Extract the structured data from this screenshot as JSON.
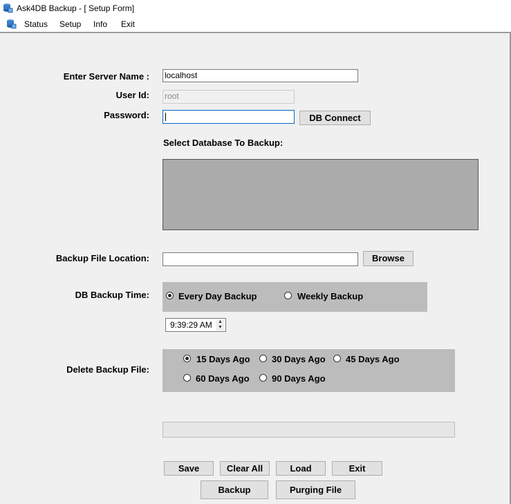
{
  "window": {
    "title": "Ask4DB Backup - [ Setup Form]"
  },
  "menu": {
    "items": [
      "Status",
      "Setup",
      "Info",
      "Exit"
    ]
  },
  "form": {
    "server_label": "Enter Server Name :",
    "server_value": "localhost",
    "userid_label": "User Id:",
    "userid_value": "root",
    "password_label": "Password:",
    "password_value": "",
    "db_connect_button": "DB Connect",
    "select_db_label": "Select Database  To Backup:",
    "backup_location_label": "Backup File Location:",
    "backup_location_value": "",
    "browse_button": "Browse",
    "backup_time_label": "DB Backup Time:",
    "backup_time_options": [
      {
        "label": "Every Day Backup",
        "checked": true
      },
      {
        "label": "Weekly Backup",
        "checked": false
      }
    ],
    "time_value": "9:39:29 AM",
    "delete_label": "Delete Backup File:",
    "delete_options": [
      {
        "label": "15 Days Ago",
        "checked": true
      },
      {
        "label": "30 Days Ago",
        "checked": false
      },
      {
        "label": "45 Days Ago",
        "checked": false
      },
      {
        "label": "60 Days Ago",
        "checked": false
      },
      {
        "label": "90 Days Ago",
        "checked": false
      }
    ]
  },
  "buttons": {
    "save": "Save",
    "clear_all": "Clear All",
    "load": "Load",
    "exit": "Exit",
    "backup": "Backup",
    "purging_file": "Purging File"
  },
  "colors": {
    "panel": "#bcbcbc",
    "listbox": "#ababab",
    "background": "#f0f0f0"
  }
}
